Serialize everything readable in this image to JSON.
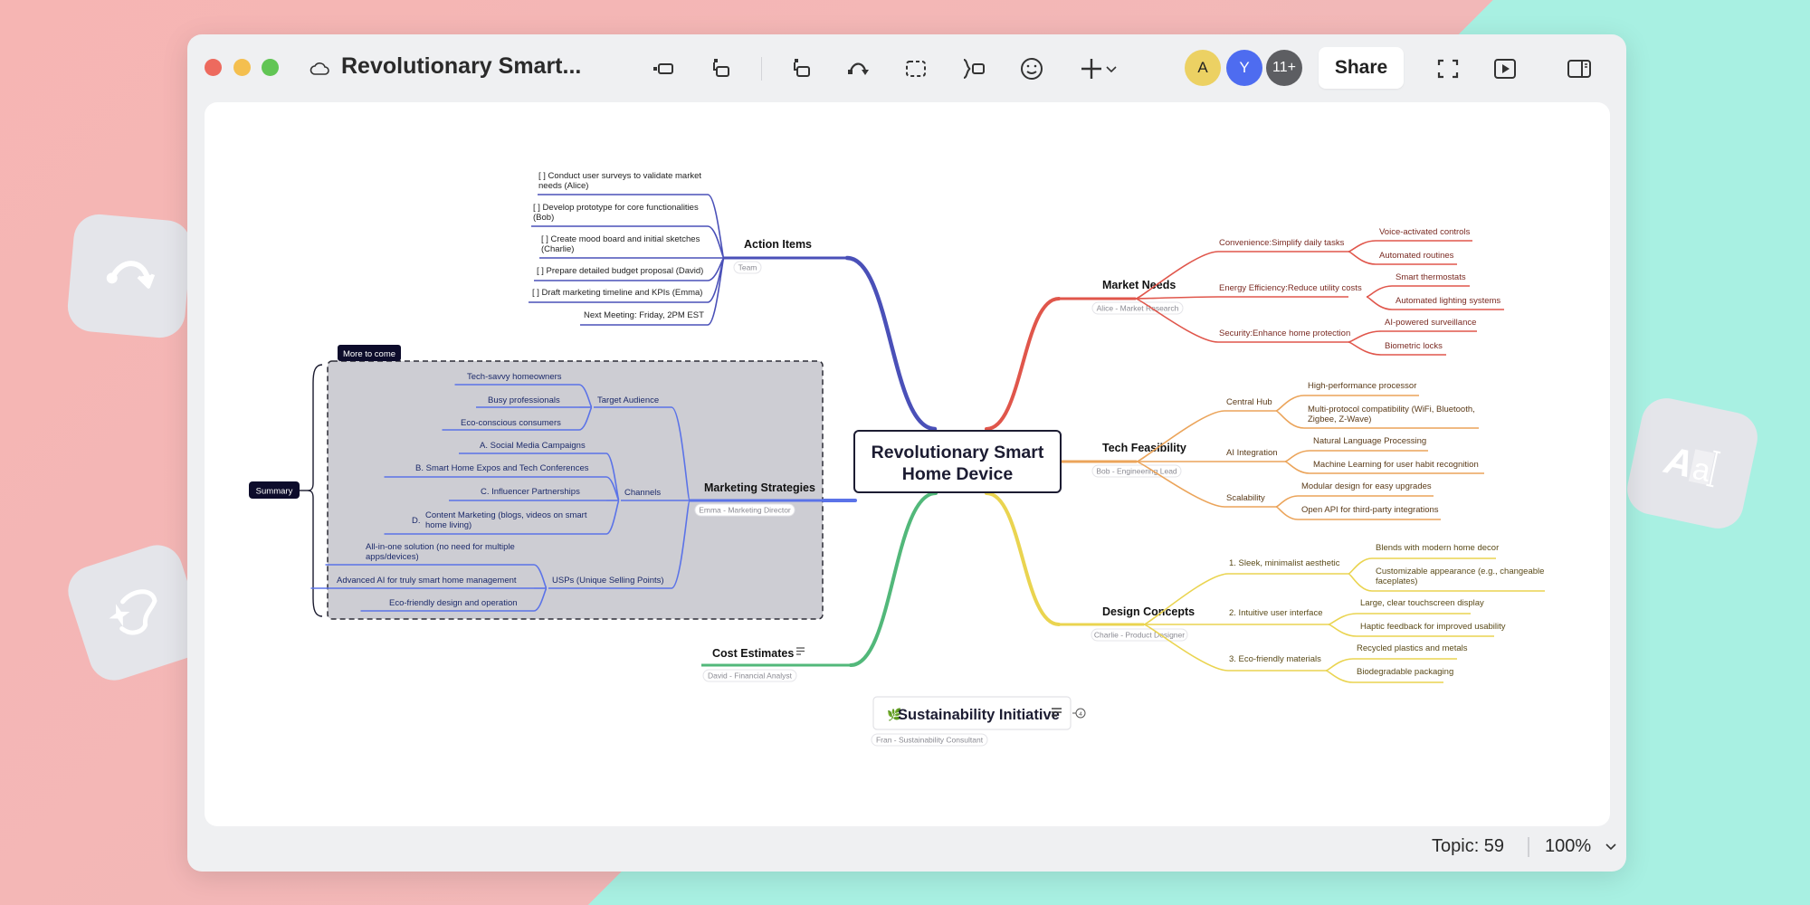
{
  "window": {
    "title": "Revolutionary Smart...",
    "toolbar": {
      "icons": [
        "insert-topic-icon",
        "insert-subtopic-icon",
        "insert-parent-icon",
        "relationship-icon",
        "boundary-icon",
        "summary-icon",
        "emoji-icon",
        "add-icon"
      ],
      "share_label": "Share",
      "avatars": [
        {
          "label": "A",
          "color": "#ecd163"
        },
        {
          "label": "Y",
          "color": "#4e6cf0"
        },
        {
          "label": "11+",
          "color": "#5d5e62"
        }
      ]
    },
    "footer": {
      "topic_count": "Topic: 59",
      "zoom_level": "100%"
    }
  },
  "mindmap": {
    "central": "Revolutionary Smart Home Device",
    "central_lines": [
      "Revolutionary Smart",
      "Home Device"
    ],
    "colors": {
      "action": "#4a50b8",
      "marketing": "#5b73e8",
      "market": "#e0564b",
      "tech": "#eba45a",
      "design": "#ead450",
      "cost": "#52b87a",
      "boundary_fill": "#cdcdd3",
      "dark_label": "#0d0c2b"
    },
    "action_items": {
      "title": "Action Items",
      "note": "Team",
      "items": [
        [
          "[ ] Conduct user surveys to validate market",
          "needs (Alice)"
        ],
        [
          "[ ] Develop prototype for core functionalities",
          "(Bob)"
        ],
        [
          "[ ] Create mood board and initial sketches",
          "(Charlie)"
        ],
        [
          "[ ] Prepare detailed budget proposal (David)"
        ],
        [
          "[ ] Draft marketing timeline and KPIs (Emma)"
        ],
        [
          "Next Meeting: Friday, 2PM EST"
        ]
      ]
    },
    "marketing": {
      "title": "Marketing Strategies",
      "note": "Emma - Marketing Director",
      "boundary_label": "More to come",
      "summary_label": "Summary",
      "groups": [
        {
          "title": "Target Audience",
          "items": [
            [
              "Tech-savvy homeowners"
            ],
            [
              "Busy professionals"
            ],
            [
              "Eco-conscious consumers"
            ]
          ]
        },
        {
          "title": "Channels",
          "items": [
            [
              "A.  Social Media Campaigns"
            ],
            [
              "B.  Smart Home Expos and Tech Conferences"
            ],
            [
              "C.   Influencer Partnerships"
            ],
            [
              "Content Marketing (blogs, videos on smart",
              "home living)"
            ]
          ],
          "d_prefix": "D."
        },
        {
          "title": "USPs (Unique Selling Points)",
          "items": [
            [
              "All-in-one solution (no need for multiple",
              "apps/devices)"
            ],
            [
              "Advanced AI for truly smart home management"
            ],
            [
              "Eco-friendly design and operation"
            ]
          ]
        }
      ]
    },
    "market_needs": {
      "title": "Market Needs",
      "note": "Alice - Market Research",
      "groups": [
        {
          "title": "Convenience:Simplify daily tasks",
          "items": [
            "Voice-activated controls",
            "Automated routines"
          ]
        },
        {
          "title": "Energy Efficiency:Reduce utility costs",
          "items": [
            "Smart thermostats",
            "Automated lighting systems"
          ]
        },
        {
          "title": "Security:Enhance home protection",
          "items": [
            "AI-powered surveillance",
            "Biometric locks"
          ]
        }
      ]
    },
    "tech": {
      "title": "Tech Feasibility",
      "note": "Bob - Engineering Lead",
      "groups": [
        {
          "title": "Central Hub",
          "items": [
            [
              "High-performance processor"
            ],
            [
              "Multi-protocol compatibility (WiFi, Bluetooth,",
              "Zigbee, Z-Wave)"
            ]
          ]
        },
        {
          "title": "AI Integration",
          "items": [
            [
              "Natural Language Processing"
            ],
            [
              "Machine Learning for user habit recognition"
            ]
          ]
        },
        {
          "title": "Scalability",
          "items": [
            [
              "Modular design for easy upgrades"
            ],
            [
              "Open API for third-party integrations"
            ]
          ]
        }
      ]
    },
    "design": {
      "title": "Design Concepts",
      "note": "Charlie - Product Designer",
      "groups": [
        {
          "title": "1. Sleek, minimalist aesthetic",
          "items": [
            [
              "Blends with modern home decor"
            ],
            [
              "Customizable appearance (e.g., changeable",
              "faceplates)"
            ]
          ]
        },
        {
          "title": "2. Intuitive user interface",
          "items": [
            [
              "Large, clear touchscreen display"
            ],
            [
              "Haptic feedback for improved usability"
            ]
          ]
        },
        {
          "title": "3. Eco-friendly materials",
          "items": [
            [
              "Recycled plastics and metals"
            ],
            [
              "Biodegradable packaging"
            ]
          ]
        }
      ]
    },
    "cost": {
      "title": "Cost Estimates",
      "note": "David - Financial Analyst"
    },
    "floating": {
      "title": "Sustainability Initiative",
      "emoji": "🌿",
      "note": "Fran - Sustainability Consultant",
      "collapsed_count": "4"
    }
  }
}
